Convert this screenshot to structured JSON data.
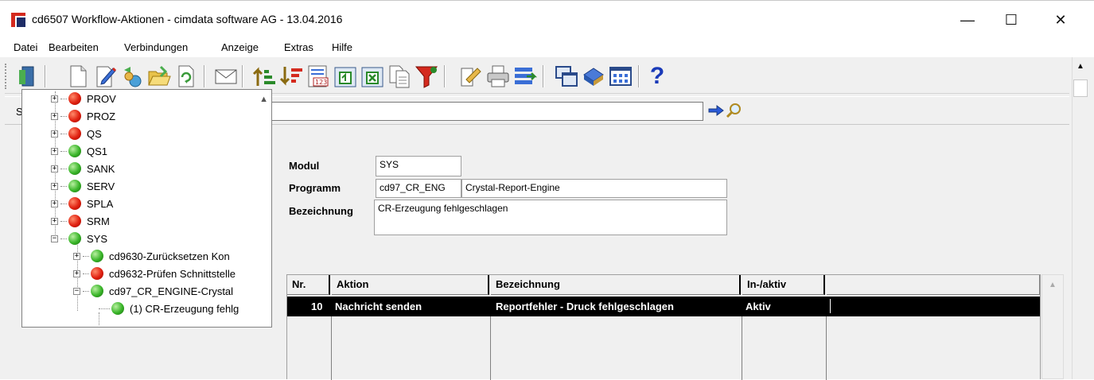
{
  "window": {
    "title": "cd6507 Workflow-Aktionen - cimdata software AG - 13.04.2016",
    "minimize_symbol": "—",
    "maximize_symbol": "☐",
    "close_symbol": "✕"
  },
  "menu": [
    "Datei",
    "Bearbeiten",
    "Verbindungen",
    "Anzeige",
    "Extras",
    "Hilfe"
  ],
  "toolbar": {
    "icons": [
      "exit-icon",
      "new-document-icon",
      "edit-icon",
      "copy-icon",
      "open-folder-icon",
      "refresh-icon",
      "mail-icon",
      "sort-ascending-icon",
      "sort-descending-icon",
      "number-format-icon",
      "export-icon",
      "excel-export-icon",
      "copy-pages-icon",
      "filter-icon",
      "notes-icon",
      "print-icon",
      "transfer-icon",
      "windows-icon",
      "archive-icon",
      "layout-icon",
      "help-icon"
    ],
    "help_symbol": "?"
  },
  "search": {
    "label": "Suche",
    "value": ""
  },
  "tree": {
    "nodes": [
      {
        "label": "PROV",
        "status": "red"
      },
      {
        "label": "PROZ",
        "status": "red"
      },
      {
        "label": "QS",
        "status": "red"
      },
      {
        "label": "QS1",
        "status": "green"
      },
      {
        "label": "SANK",
        "status": "green"
      },
      {
        "label": "SERV",
        "status": "green"
      },
      {
        "label": "SPLA",
        "status": "red"
      },
      {
        "label": "SRM",
        "status": "red"
      },
      {
        "label": "SYS",
        "status": "green"
      }
    ],
    "children": [
      {
        "label": "cd9630-Zurücksetzen Kon",
        "status": "green"
      },
      {
        "label": "cd9632-Prüfen Schnittstelle",
        "status": "red"
      },
      {
        "label": "cd97_CR_ENGINE-Crystal",
        "status": "green"
      }
    ],
    "leaf": {
      "label": "(1) CR-Erzeugung fehlg",
      "status": "green"
    }
  },
  "form": {
    "modul_label": "Modul",
    "modul_value": "SYS",
    "programm_label": "Programm",
    "programm_code": "cd97_CR_ENG",
    "programm_name": "Crystal-Report-Engine",
    "bezeichnung_label": "Bezeichnung",
    "bezeichnung_value": "CR-Erzeugung fehlgeschlagen"
  },
  "grid": {
    "headers": [
      "Nr.",
      "Aktion",
      "Bezeichnung",
      "In-/aktiv"
    ],
    "rows": [
      {
        "nr": "10",
        "aktion": "Nachricht senden",
        "bezeichnung": "Reportfehler - Druck fehlgeschlagen",
        "status": "Aktiv"
      }
    ]
  }
}
